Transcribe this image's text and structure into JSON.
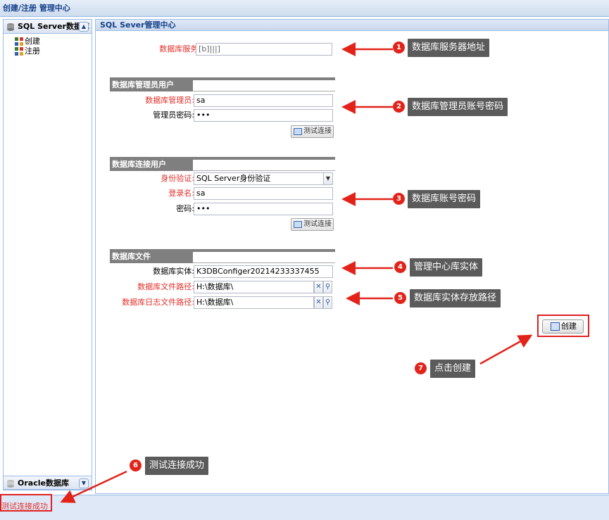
{
  "window": {
    "title": "创建/注册 管理中心"
  },
  "sidebar": {
    "sql_header": "SQL Server数据库",
    "items": [
      {
        "label": "创建"
      },
      {
        "label": "注册"
      }
    ],
    "oracle_header": "Oracle数据库"
  },
  "main": {
    "header": "SQL Sever管理中心",
    "server": {
      "label": "数据库服务器:",
      "value": "                [b]|||]"
    },
    "admin": {
      "section": "数据库管理员用户",
      "user_label": "数据库管理员:",
      "user_value": "sa",
      "pwd_label": "管理员密码:",
      "pwd_value": "•••",
      "test_label": "测试连接"
    },
    "conn": {
      "section": "数据库连接用户",
      "auth_label": "身份验证:",
      "auth_value": "SQL Server身份验证",
      "login_label": "登录名:",
      "login_value": "sa",
      "pwd_label": "密码:",
      "pwd_value": "•••",
      "test_label": "测试连接"
    },
    "files": {
      "section": "数据库文件",
      "entity_label": "数据库实体:",
      "entity_value": "K3DBConfiger20214233337455",
      "path_label": "数据库文件路径:",
      "path_value": "H:\\数据库\\",
      "log_label": "数据库日志文件路径:",
      "log_value": "H:\\数据库\\"
    },
    "create_label": "创建"
  },
  "status": {
    "text": "测试连接成功"
  },
  "callouts": [
    {
      "num": "1",
      "text": "数据库服务器地址"
    },
    {
      "num": "2",
      "text": "数据库管理员账号密码"
    },
    {
      "num": "3",
      "text": "数据库账号密码"
    },
    {
      "num": "4",
      "text": "管理中心库实体"
    },
    {
      "num": "5",
      "text": "数据库实体存放路径"
    },
    {
      "num": "6",
      "text": "测试连接成功"
    },
    {
      "num": "7",
      "text": "点击创建"
    }
  ],
  "colors": {
    "accent": "#15428b",
    "border": "#99bbe8",
    "required": "#e0302a",
    "annotation": "#e2231a"
  }
}
